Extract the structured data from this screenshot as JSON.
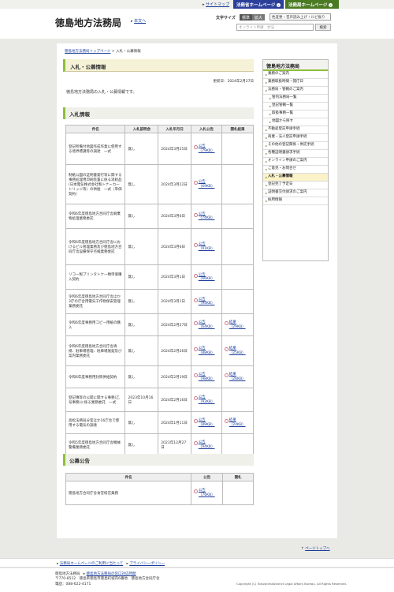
{
  "topbar": {
    "sitemap": "サイトマップ",
    "moj_home": "法務省ホームページ",
    "bureau_home": "法務局ホームページ"
  },
  "header": {
    "title": "徳島地方法務局",
    "home_link": "本文へ",
    "font_size_label": "文字サイズ",
    "font_standard": "標準",
    "font_large": "拡大",
    "color_button": "色変更・音声読み上げ・ルビ振り",
    "search_placeholder": "オンライン申請　文法",
    "search_button": "検索"
  },
  "breadcrumb": {
    "home": "徳島地方法務局トップページ",
    "sep": ">",
    "current": "入札・公募情報"
  },
  "page": {
    "title": "入札・公募情報",
    "updated": "更新日：2024年2月27日",
    "intro": "徳島地方法務局の入札・公募情報です。"
  },
  "bids": {
    "heading": "入札情報",
    "headers": [
      "件名",
      "入札説明会",
      "入札年月日",
      "入札公告",
      "開札結果"
    ],
    "rows": [
      {
        "name": "登記所備付地図作成作業に使用する境界標識等の調達　一式",
        "briefing": "無し",
        "date": "2024年3月25日",
        "notice": "公告（79KB）",
        "result": ""
      },
      {
        "name": "制紙公図の証明書発行等に関する事務処理用印刷装置に係る消耗品(日本電気株式会社製トナーカートリッジ等）の供給　一式（単価契約）",
        "briefing": "無し",
        "date": "2024年3月22日",
        "notice": "公告（69KB）",
        "result": ""
      },
      {
        "name": "令和6年度徳島地方合同庁舎廃棄物処理業務委託",
        "briefing": "無し",
        "date": "2024年3月6日",
        "notice": "公告（74KB）",
        "result": ""
      },
      {
        "name": "令和6年度徳島地方合同庁舎におけるビル管理業務及び徳島地方合同庁舎設備保守点検業務委託",
        "briefing": "無し",
        "date": "2024年3月6日",
        "notice": "公告（91KB）",
        "result": ""
      },
      {
        "name": "リコー製プリンタトナー類単価購入契約",
        "briefing": "無し",
        "date": "2024年3月1日",
        "notice": "公告（66KB）",
        "result": ""
      },
      {
        "name": "令和6年度徳島地方合同庁舎ほか3庁の庁舎用電気工作物保安管理業務委託",
        "briefing": "無し",
        "date": "2024年3月1日",
        "notice": "公告（94KB）",
        "result": ""
      },
      {
        "name": "令和6年度事務用コピー用紙の購入",
        "briefing": "無し",
        "date": "2024年2月27日",
        "notice": "公告（64KB）",
        "result": "結果（29KB）"
      },
      {
        "name": "令和6年度徳島地方合同庁舎清掃、駐車場管理、駐車場施錠及び案内業務委託",
        "briefing": "無し",
        "date": "2024年2月26日",
        "notice": "公告（88KB）",
        "result": "結果（25KB）"
      },
      {
        "name": "令和6年度事務用封筒供給契約",
        "briefing": "無し",
        "date": "2024年2月19日",
        "notice": "公告（98KB）",
        "result": "結果（26KB）"
      },
      {
        "name": "登記簿等の公開に関する事務(乙号事務)に係る業務委託　一式",
        "briefing": "2023年10月16日",
        "date": "2024年2月16日",
        "notice": "公告（92KB）",
        "result": ""
      },
      {
        "name": "高松法務局分室ほか16庁舎で使用する電気の調達",
        "briefing": "無し",
        "date": "2024年1月11日",
        "notice": "公告（89KB）",
        "result": "結果（24KB）"
      },
      {
        "name": "令和5年度徳島地方合同庁舎機械警備業務委託",
        "briefing": "無し",
        "date": "2023年12月27日",
        "notice": "公告（94KB）",
        "result": ""
      }
    ]
  },
  "public": {
    "heading": "公募公告",
    "headers": [
      "件名",
      "公告",
      "開札"
    ],
    "rows": [
      {
        "name": "徳島地方合同庁舎食堂経営業務",
        "notice": "公告（76KB）",
        "result": ""
      }
    ]
  },
  "sidebar": {
    "title": "徳島地方法務局",
    "items": [
      {
        "label": "業務のご案内",
        "sub": false,
        "active": false
      },
      {
        "label": "業務取扱時間・開庁日",
        "sub": false,
        "active": false
      },
      {
        "label": "法務局・管轄のご案内",
        "sub": false,
        "active": false
      },
      {
        "label": "管内法務局一覧",
        "sub": true,
        "active": false
      },
      {
        "label": "登記管轄一覧",
        "sub": true,
        "active": false
      },
      {
        "label": "取扱事務一覧",
        "sub": true,
        "active": false
      },
      {
        "label": "地図から探す",
        "sub": true,
        "active": false
      },
      {
        "label": "不動産登記申請手続",
        "sub": false,
        "active": false
      },
      {
        "label": "商業・法人登記申請手続",
        "sub": false,
        "active": false
      },
      {
        "label": "その他の登記関係・供託手続",
        "sub": false,
        "active": false
      },
      {
        "label": "各種証明書請求手続",
        "sub": false,
        "active": false
      },
      {
        "label": "オンライン申請のご案内",
        "sub": false,
        "active": false
      },
      {
        "label": "ご意見・お問合せ",
        "sub": false,
        "active": false
      },
      {
        "label": "入札・公募情報",
        "sub": false,
        "active": true
      },
      {
        "label": "登記完了予定日",
        "sub": false,
        "active": false
      },
      {
        "label": "証明書交付請求のご案内",
        "sub": false,
        "active": false
      },
      {
        "label": "採用情報",
        "sub": false,
        "active": false
      }
    ]
  },
  "pagetop": "ページトップへ",
  "footer": {
    "link1": "法務局ホームページのご利用に当たって",
    "link2": "プライバシーポリシー",
    "name": "徳島地方法務局",
    "window_link": "徳島地方法務局の窓口対応時間",
    "address": "〒770-8512　徳島県徳島市徳島町城内6番地　徳島地方合同庁舎",
    "tel": "電話：088-622-4171",
    "copyright": "Copyright (C) TokushimaDistrict Legal Affairs Bureau. All Rights Reserved."
  }
}
